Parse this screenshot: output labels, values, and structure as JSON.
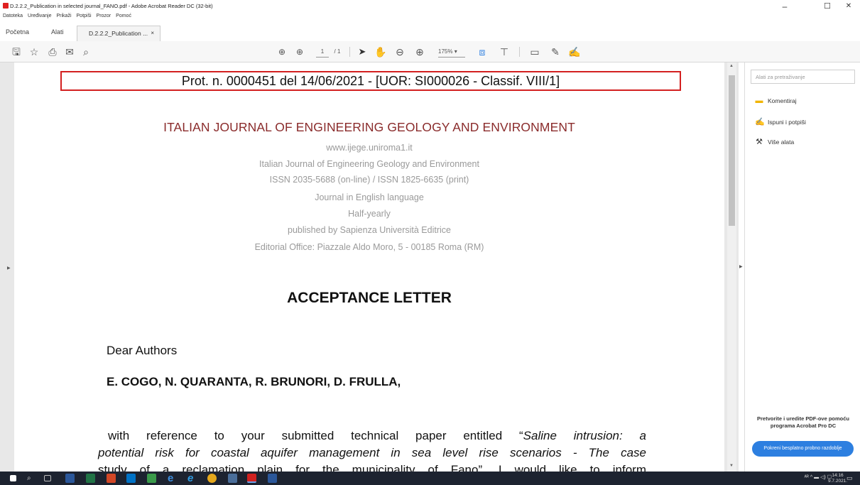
{
  "window": {
    "title": "D.2.2.2_Publication in selected journal_FANO.pdf - Adobe Acrobat Reader DC (32-bit)",
    "minimize": "–",
    "maximize": "☐",
    "close": "✕"
  },
  "menu": [
    "Datoteka",
    "Uređivanje",
    "Prikaži",
    "Potpiši",
    "Prozor",
    "Pomoć"
  ],
  "tabs": {
    "home": "Početna",
    "tools": "Alati",
    "document": "D.2.2.2_Publication ...",
    "close": "×"
  },
  "toolbar": {
    "page_current": "1",
    "page_total": "/ 1",
    "zoom": "175%"
  },
  "document": {
    "protocol": "Prot. n. 0000451 del 14/06/2021 - [UOR: SI000026 - Classif. VIII/1]",
    "journal_title": "ITALIAN JOURNAL OF ENGINEERING GEOLOGY AND ENVIRONMENT",
    "info_lines": [
      "www.ijege.uniroma1.it",
      "Italian Journal of Engineering Geology and Environment",
      "ISSN 2035-5688 (on-line) / ISSN 1825-6635 (print)",
      "Journal in English language",
      "Half-yearly",
      "published by Sapienza Università Editrice",
      "Editorial Office: Piazzale Aldo Moro, 5 - 00185 Roma (RM)"
    ],
    "heading": "ACCEPTANCE LETTER",
    "greeting": "Dear Authors",
    "authors": "E. COGO, N. QUARANTA, R. BRUNORI,  D. FRULLA,",
    "body_line1_plain": "with reference to your submitted technical paper entitled “",
    "body_line1_italic": "Saline intrusion: a",
    "body_line2": "potential risk for coastal aquifer management in sea level rise scenarios - The case",
    "body_line3": "study of a reclamation plain for the municipality of Fano”, I would like to inform"
  },
  "right_pane": {
    "search_placeholder": "Alati za pretraživanje",
    "tools": [
      {
        "label": "Komentiraj",
        "color": "#f0b400"
      },
      {
        "label": "Ispuni i potpiši",
        "color": "#7a4fd0"
      },
      {
        "label": "Više alata",
        "color": "#333333"
      }
    ],
    "promo": "Pretvorite i uredite PDF-ove pomoću programa Acrobat Pro DC",
    "trial_button": "Pokreni besplatno probno razdoblje"
  },
  "taskbar": {
    "tray": "ᴬᴿ ^ ▬ ◁) ☐",
    "time": "14:16",
    "date": "9.7.2021."
  },
  "colors": {
    "accent": "#2d7fe0",
    "protocol_border": "#d32020",
    "journal_title": "#8a2b2b"
  }
}
